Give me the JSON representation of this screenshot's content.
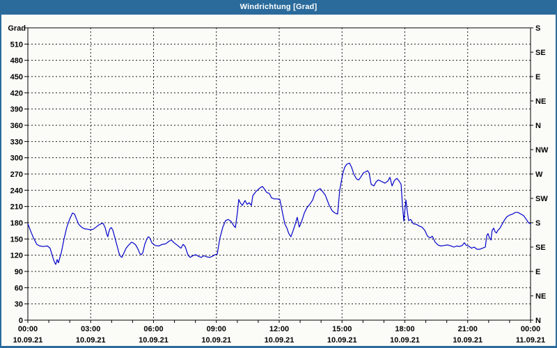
{
  "window": {
    "title": "Windrichtung [Grad]"
  },
  "colors": {
    "titlebar_bg": "#2a6b9c",
    "border": "#2a6b9c",
    "chart_bg": "#fbfbf7",
    "frame": "#000000",
    "grid": "#1a1a1a",
    "text": "#000000",
    "line": "#0000cc"
  },
  "chart_data": {
    "type": "line",
    "title": "Windrichtung [Grad]",
    "grid": {
      "style": "dashed",
      "horizontal_step_deg": 30,
      "vertical_step_hours": 3
    },
    "x_axis": {
      "unit": "time",
      "range_hours": [
        0,
        24
      ],
      "minor_tick_every_hours": 1,
      "major_tick_every_hours": 3,
      "labels": [
        {
          "time": "00:00",
          "date": "10.09.21"
        },
        {
          "time": "03:00",
          "date": "10.09.21"
        },
        {
          "time": "06:00",
          "date": "10.09.21"
        },
        {
          "time": "09:00",
          "date": "10.09.21"
        },
        {
          "time": "12:00",
          "date": "10.09.21"
        },
        {
          "time": "15:00",
          "date": "10.09.21"
        },
        {
          "time": "18:00",
          "date": "10.09.21"
        },
        {
          "time": "21:00",
          "date": "10.09.21"
        },
        {
          "time": "00:00",
          "date": "11.09.21"
        }
      ]
    },
    "y_axis_left": {
      "label": "Grad",
      "min": 0,
      "max": 540,
      "tick_step": 30,
      "tick_labels": [
        "0",
        "30",
        "60",
        "90",
        "120",
        "150",
        "180",
        "210",
        "240",
        "270",
        "300",
        "330",
        "360",
        "390",
        "420",
        "450",
        "480",
        "510"
      ]
    },
    "y_axis_right": {
      "tick_step_deg": 45,
      "compass_cycle": [
        "N",
        "NE",
        "E",
        "SE",
        "S",
        "SW",
        "W",
        "NW"
      ],
      "labels_bottom_to_top": [
        "N",
        "NE",
        "E",
        "SE",
        "S",
        "SW",
        "W",
        "NW",
        "N",
        "NE",
        "E",
        "SE",
        "S"
      ]
    },
    "series": [
      {
        "name": "Windrichtung",
        "color": "#0000cc",
        "points": [
          [
            0.0,
            178
          ],
          [
            0.13,
            165
          ],
          [
            0.27,
            152
          ],
          [
            0.43,
            140
          ],
          [
            0.57,
            137
          ],
          [
            0.73,
            136
          ],
          [
            0.93,
            137
          ],
          [
            1.06,
            133
          ],
          [
            1.16,
            120
          ],
          [
            1.26,
            108
          ],
          [
            1.33,
            103
          ],
          [
            1.4,
            112
          ],
          [
            1.46,
            106
          ],
          [
            1.6,
            125
          ],
          [
            1.73,
            150
          ],
          [
            1.86,
            172
          ],
          [
            1.99,
            186
          ],
          [
            2.13,
            198
          ],
          [
            2.23,
            196
          ],
          [
            2.33,
            186
          ],
          [
            2.43,
            177
          ],
          [
            2.56,
            172
          ],
          [
            2.69,
            169
          ],
          [
            2.86,
            168
          ],
          [
            2.99,
            167
          ],
          [
            3.12,
            168
          ],
          [
            3.26,
            172
          ],
          [
            3.39,
            176
          ],
          [
            3.49,
            178
          ],
          [
            3.59,
            179
          ],
          [
            3.69,
            171
          ],
          [
            3.76,
            160
          ],
          [
            3.82,
            154
          ],
          [
            3.86,
            162
          ],
          [
            3.92,
            169
          ],
          [
            3.99,
            171
          ],
          [
            4.06,
            166
          ],
          [
            4.16,
            152
          ],
          [
            4.26,
            137
          ],
          [
            4.35,
            124
          ],
          [
            4.42,
            118
          ],
          [
            4.49,
            116
          ],
          [
            4.55,
            121
          ],
          [
            4.69,
            133
          ],
          [
            4.82,
            139
          ],
          [
            4.95,
            144
          ],
          [
            5.02,
            143
          ],
          [
            5.15,
            139
          ],
          [
            5.25,
            132
          ],
          [
            5.35,
            123
          ],
          [
            5.42,
            121
          ],
          [
            5.49,
            125
          ],
          [
            5.58,
            140
          ],
          [
            5.68,
            150
          ],
          [
            5.75,
            154
          ],
          [
            5.82,
            152
          ],
          [
            5.92,
            143
          ],
          [
            5.98,
            141
          ],
          [
            6.08,
            138
          ],
          [
            6.25,
            137
          ],
          [
            6.42,
            140
          ],
          [
            6.58,
            141
          ],
          [
            6.75,
            146
          ],
          [
            6.85,
            148
          ],
          [
            6.98,
            143
          ],
          [
            7.15,
            138
          ],
          [
            7.31,
            133
          ],
          [
            7.41,
            140
          ],
          [
            7.51,
            136
          ],
          [
            7.65,
            120
          ],
          [
            7.75,
            116
          ],
          [
            7.88,
            119
          ],
          [
            8.01,
            121
          ],
          [
            8.14,
            118
          ],
          [
            8.28,
            116
          ],
          [
            8.41,
            119
          ],
          [
            8.54,
            117
          ],
          [
            8.68,
            116
          ],
          [
            8.81,
            118
          ],
          [
            8.94,
            121
          ],
          [
            9.04,
            122
          ],
          [
            9.17,
            152
          ],
          [
            9.31,
            172
          ],
          [
            9.44,
            184
          ],
          [
            9.57,
            186
          ],
          [
            9.71,
            182
          ],
          [
            9.84,
            174
          ],
          [
            9.91,
            171
          ],
          [
            10.01,
            200
          ],
          [
            10.07,
            223
          ],
          [
            10.14,
            217
          ],
          [
            10.24,
            212
          ],
          [
            10.37,
            221
          ],
          [
            10.47,
            214
          ],
          [
            10.57,
            217
          ],
          [
            10.67,
            212
          ],
          [
            10.74,
            230
          ],
          [
            10.9,
            238
          ],
          [
            11.07,
            244
          ],
          [
            11.2,
            247
          ],
          [
            11.3,
            242
          ],
          [
            11.4,
            236
          ],
          [
            11.53,
            234
          ],
          [
            11.63,
            226
          ],
          [
            11.77,
            224
          ],
          [
            11.9,
            224
          ],
          [
            12.03,
            223
          ],
          [
            12.1,
            210
          ],
          [
            12.17,
            196
          ],
          [
            12.27,
            178
          ],
          [
            12.37,
            170
          ],
          [
            12.46,
            160
          ],
          [
            12.56,
            154
          ],
          [
            12.66,
            165
          ],
          [
            12.77,
            178
          ],
          [
            12.86,
            190
          ],
          [
            12.96,
            172
          ],
          [
            13.06,
            181
          ],
          [
            13.2,
            198
          ],
          [
            13.33,
            208
          ],
          [
            13.46,
            214
          ],
          [
            13.6,
            222
          ],
          [
            13.73,
            237
          ],
          [
            13.86,
            241
          ],
          [
            13.96,
            243
          ],
          [
            14.1,
            236
          ],
          [
            14.2,
            231
          ],
          [
            14.3,
            221
          ],
          [
            14.39,
            212
          ],
          [
            14.53,
            202
          ],
          [
            14.66,
            198
          ],
          [
            14.79,
            196
          ],
          [
            14.89,
            240
          ],
          [
            15.03,
            270
          ],
          [
            15.12,
            282
          ],
          [
            15.22,
            288
          ],
          [
            15.36,
            290
          ],
          [
            15.46,
            282
          ],
          [
            15.56,
            270
          ],
          [
            15.69,
            261
          ],
          [
            15.79,
            259
          ],
          [
            15.89,
            264
          ],
          [
            16.02,
            272
          ],
          [
            16.12,
            274
          ],
          [
            16.22,
            276
          ],
          [
            16.29,
            272
          ],
          [
            16.39,
            251
          ],
          [
            16.52,
            248
          ],
          [
            16.62,
            255
          ],
          [
            16.72,
            259
          ],
          [
            16.85,
            257
          ],
          [
            16.95,
            255
          ],
          [
            17.05,
            253
          ],
          [
            17.19,
            257
          ],
          [
            17.29,
            264
          ],
          [
            17.39,
            248
          ],
          [
            17.5,
            258
          ],
          [
            17.62,
            262
          ],
          [
            17.72,
            257
          ],
          [
            17.82,
            251
          ],
          [
            17.88,
            215
          ],
          [
            17.95,
            183
          ],
          [
            18.05,
            222
          ],
          [
            18.12,
            200
          ],
          [
            18.18,
            184
          ],
          [
            18.28,
            186
          ],
          [
            18.41,
            178
          ],
          [
            18.55,
            177
          ],
          [
            18.68,
            174
          ],
          [
            18.81,
            172
          ],
          [
            18.95,
            166
          ],
          [
            19.08,
            155
          ],
          [
            19.21,
            152
          ],
          [
            19.31,
            155
          ],
          [
            19.45,
            144
          ],
          [
            19.58,
            139
          ],
          [
            19.71,
            137
          ],
          [
            19.88,
            138
          ],
          [
            20.04,
            139
          ],
          [
            20.21,
            137
          ],
          [
            20.34,
            135
          ],
          [
            20.48,
            137
          ],
          [
            20.61,
            136
          ],
          [
            20.74,
            138
          ],
          [
            20.84,
            143
          ],
          [
            20.94,
            138
          ],
          [
            21.04,
            137
          ],
          [
            21.18,
            133
          ],
          [
            21.31,
            135
          ],
          [
            21.44,
            131
          ],
          [
            21.58,
            131
          ],
          [
            21.71,
            133
          ],
          [
            21.84,
            135
          ],
          [
            21.91,
            156
          ],
          [
            21.97,
            160
          ],
          [
            22.04,
            152
          ],
          [
            22.11,
            148
          ],
          [
            22.17,
            166
          ],
          [
            22.24,
            170
          ],
          [
            22.31,
            163
          ],
          [
            22.37,
            161
          ],
          [
            22.44,
            166
          ],
          [
            22.54,
            170
          ],
          [
            22.61,
            175
          ],
          [
            22.74,
            184
          ],
          [
            22.87,
            191
          ],
          [
            23.0,
            194
          ],
          [
            23.14,
            196
          ],
          [
            23.27,
            199
          ],
          [
            23.4,
            199
          ],
          [
            23.54,
            196
          ],
          [
            23.67,
            193
          ],
          [
            23.8,
            186
          ],
          [
            23.9,
            180
          ],
          [
            24.0,
            178
          ]
        ]
      }
    ]
  }
}
